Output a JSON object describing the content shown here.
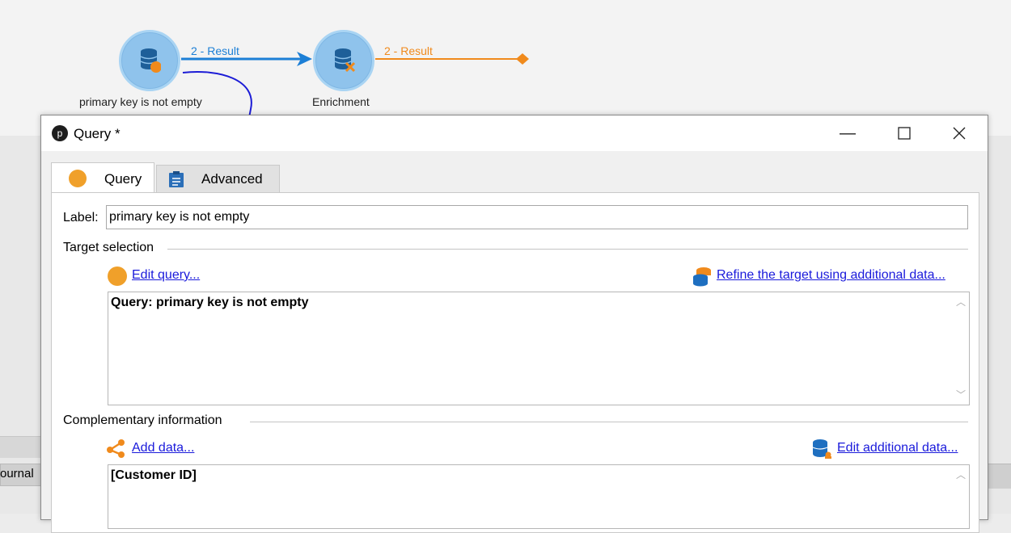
{
  "workflow": {
    "node1_label": "primary key is not empty",
    "node2_label": "Enrichment",
    "transition1_label": "2 - Result",
    "transition2_label": "2 - Result"
  },
  "background_panel": {
    "journal_label": "ournal"
  },
  "dialog": {
    "title": "Query *",
    "tabs": [
      {
        "label": "Query",
        "active": true
      },
      {
        "label": "Advanced",
        "active": false
      }
    ],
    "label_field": {
      "caption": "Label:",
      "value": "primary key is not empty"
    },
    "target_selection": {
      "heading": "Target selection",
      "edit_query_link": "Edit query...",
      "refine_link": "Refine the target using additional data...",
      "query_text": "Query: primary key is not empty"
    },
    "complementary": {
      "heading": "Complementary information",
      "add_data_link": "Add data...",
      "edit_additional_link": "Edit additional data...",
      "content_text": "[Customer ID]"
    }
  },
  "colors": {
    "node_blue": "#8fc3ec",
    "transition_blue": "#1c7fd6",
    "transition_orange": "#f08a1c",
    "link_blue": "#1a1adb",
    "query_orange": "#f0a02a",
    "annotation_ink": "#1c1cd6"
  }
}
